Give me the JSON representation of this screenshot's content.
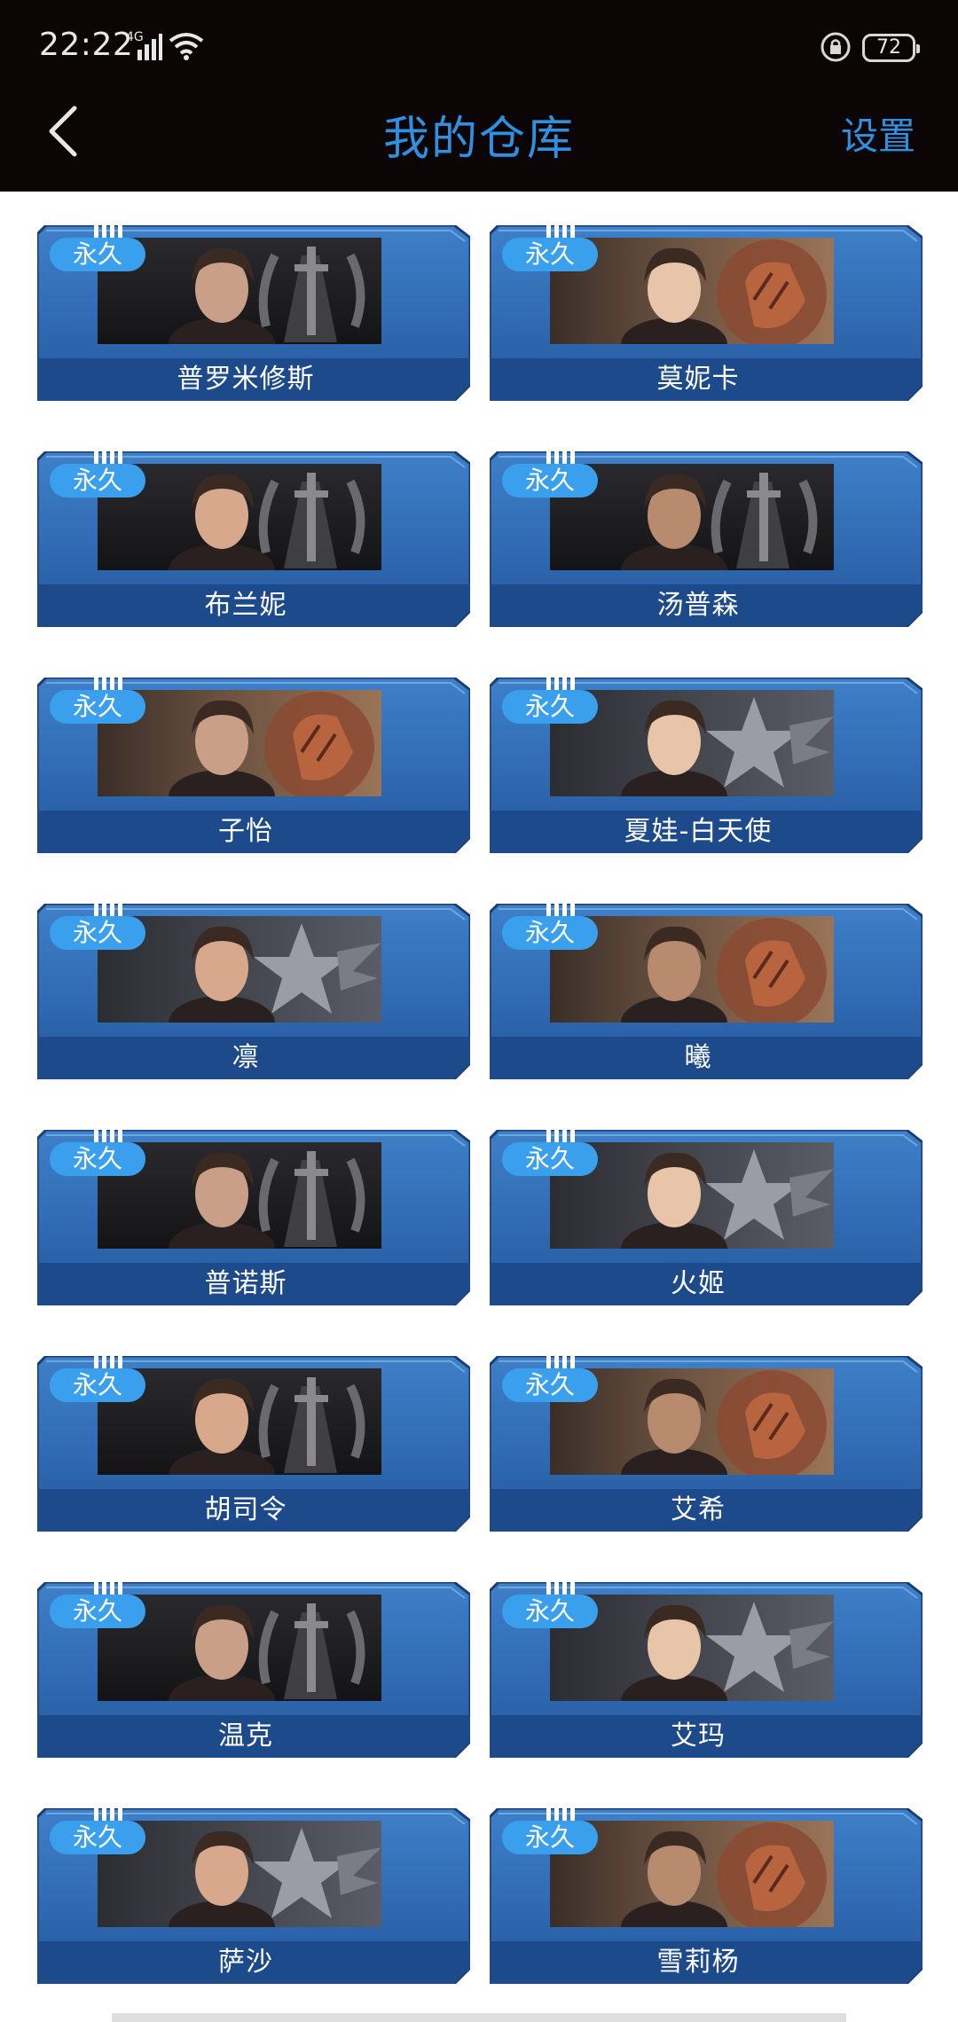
{
  "status_bar": {
    "time": "22:22",
    "network": "4G",
    "battery": "72"
  },
  "header": {
    "title": "我的仓库",
    "settings_label": "设置"
  },
  "colors": {
    "accent": "#2f8fe0",
    "tag": "#3aa0ee",
    "card_blue": "#2a62a8"
  },
  "items": [
    {
      "tag": "永久",
      "name": "普罗米修斯",
      "emblem": "sword-emblem",
      "bg": "dark"
    },
    {
      "tag": "永久",
      "name": "莫妮卡",
      "emblem": "fist-emblem",
      "bg": "bronze"
    },
    {
      "tag": "永久",
      "name": "布兰妮",
      "emblem": "sword-emblem",
      "bg": "dark"
    },
    {
      "tag": "永久",
      "name": "汤普森",
      "emblem": "sword-emblem",
      "bg": "dark"
    },
    {
      "tag": "永久",
      "name": "子怡",
      "emblem": "fist-emblem",
      "bg": "bronze"
    },
    {
      "tag": "永久",
      "name": "夏娃-白天使",
      "emblem": "star-emblem",
      "bg": "silver"
    },
    {
      "tag": "永久",
      "name": "凛",
      "emblem": "star-emblem",
      "bg": "silver"
    },
    {
      "tag": "永久",
      "name": "曦",
      "emblem": "fist-emblem",
      "bg": "bronze"
    },
    {
      "tag": "永久",
      "name": "普诺斯",
      "emblem": "sword-emblem",
      "bg": "dark"
    },
    {
      "tag": "永久",
      "name": "火姬",
      "emblem": "star-emblem",
      "bg": "silver"
    },
    {
      "tag": "永久",
      "name": "胡司令",
      "emblem": "sword-emblem",
      "bg": "dark"
    },
    {
      "tag": "永久",
      "name": "艾希",
      "emblem": "fist-emblem",
      "bg": "bronze"
    },
    {
      "tag": "永久",
      "name": "温克",
      "emblem": "sword-emblem",
      "bg": "dark"
    },
    {
      "tag": "永久",
      "name": "艾玛",
      "emblem": "star-emblem",
      "bg": "silver"
    },
    {
      "tag": "永久",
      "name": "萨沙",
      "emblem": "star-emblem",
      "bg": "silver"
    },
    {
      "tag": "永久",
      "name": "雪莉杨",
      "emblem": "fist-emblem",
      "bg": "bronze"
    }
  ]
}
